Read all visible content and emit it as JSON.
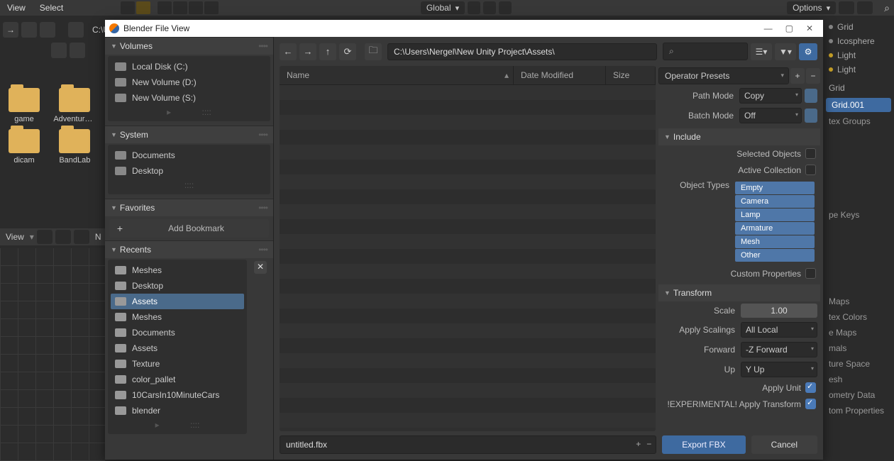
{
  "bg": {
    "menu1": "View",
    "menu2": "Select",
    "global": "Global",
    "options": "Options",
    "view3": "View",
    "N": "N",
    "path": "C:\\U",
    "thumbs": [
      "game",
      "Adventure_Jel...",
      "dicam",
      "BandLab"
    ],
    "outliner": [
      "Grid",
      "Icosphere",
      "Light",
      "Light",
      "Grid",
      "Gri..."
    ],
    "selected": "Grid.001",
    "props": [
      "tex Groups",
      "pe Keys",
      "Maps",
      "tex Colors",
      "e Maps",
      "mals",
      "ture Space",
      "esh",
      "ometry Data",
      "tom Properties"
    ]
  },
  "dialog": {
    "title": "Blender File View",
    "sidebar": {
      "volumes": {
        "title": "Volumes",
        "items": [
          "Local Disk (C:)",
          "New Volume (D:)",
          "New Volume (S:)"
        ]
      },
      "system": {
        "title": "System",
        "items": [
          "Documents",
          "Desktop"
        ]
      },
      "favorites": {
        "title": "Favorites",
        "add": "Add Bookmark"
      },
      "recents": {
        "title": "Recents",
        "items": [
          "Meshes",
          "Desktop",
          "Assets",
          "Meshes",
          "Documents",
          "Assets",
          "Texture",
          "color_pallet",
          "10CarsIn10MinuteCars",
          "blender"
        ],
        "selected": 2
      }
    },
    "path": "C:\\Users\\Nergel\\New Unity Project\\Assets\\",
    "search": "⌕",
    "cols": {
      "c1": "Name",
      "c2": "Date Modified",
      "c3": "Size"
    },
    "right": {
      "operator_presets": "Operator Presets",
      "path_mode": {
        "label": "Path Mode",
        "value": "Copy"
      },
      "batch_mode": {
        "label": "Batch Mode",
        "value": "Off"
      },
      "include": "Include",
      "selected_objects": "Selected Objects",
      "active_collection": "Active Collection",
      "object_types": {
        "label": "Object Types",
        "items": [
          "Empty",
          "Camera",
          "Lamp",
          "Armature",
          "Mesh",
          "Other"
        ]
      },
      "custom_props": "Custom Properties",
      "transform": "Transform",
      "scale": {
        "label": "Scale",
        "value": "1.00"
      },
      "apply_scalings": {
        "label": "Apply Scalings",
        "value": "All Local"
      },
      "forward": {
        "label": "Forward",
        "value": "-Z Forward"
      },
      "up": {
        "label": "Up",
        "value": "Y Up"
      },
      "apply_unit": "Apply Unit",
      "apply_transform": "!EXPERIMENTAL! Apply Transform"
    },
    "filename": "untitled.fbx",
    "export": "Export FBX",
    "cancel": "Cancel"
  }
}
